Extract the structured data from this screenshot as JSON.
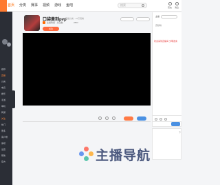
{
  "nav": {
    "items": [
      "首页",
      "分类",
      "赛事",
      "视频",
      "游戏",
      "鱼吧"
    ],
    "active_index": 0
  },
  "search": {
    "placeholder": "搜索"
  },
  "top_icons": [
    "历史",
    "消息"
  ],
  "stream": {
    "title": "口袋黄刻pvp",
    "meta": "直播分类 · 15万观看",
    "sub": "主播等级 · 关注数",
    "fans": "2863",
    "follow_label": "关注"
  },
  "sidebar": {
    "items": [
      "推荐",
      "直播",
      "分类",
      "电竞",
      "娱乐",
      "手游",
      "单机",
      "网游",
      "关注",
      "热门",
      "更多",
      "客户端",
      "鱼吧",
      "设置",
      "帮助",
      "官方"
    ]
  },
  "right_panel": {
    "label": "主播",
    "row2": "贡献榜",
    "notice": "欢迎来到直播间·文明发言"
  },
  "watermark": {
    "text": "主播导航"
  },
  "colors": {
    "accent": "#ff6a00",
    "sidebar": "#2b2e36",
    "blue": "#4a90e2"
  }
}
